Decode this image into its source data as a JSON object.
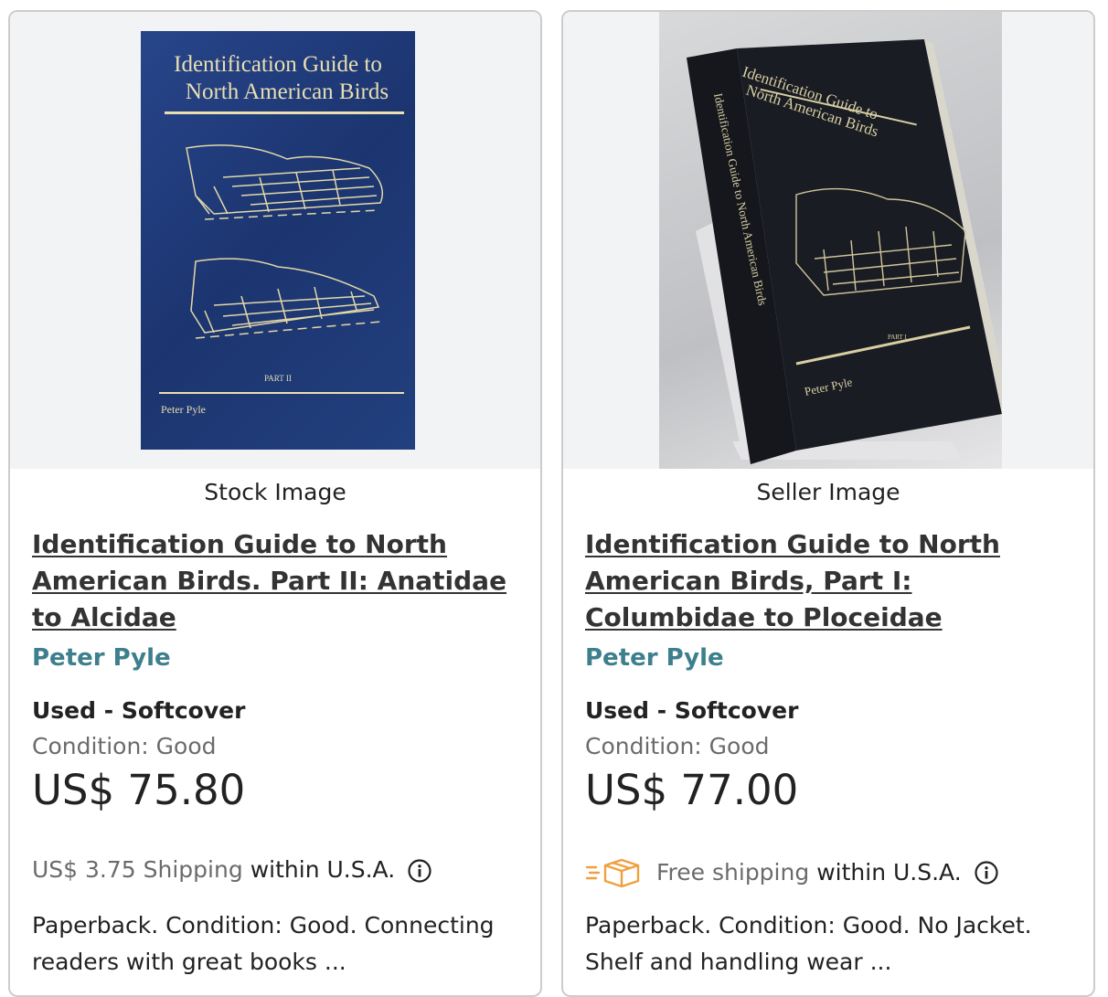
{
  "cards": [
    {
      "image_label": "Stock Image",
      "cover": {
        "title_line1": "Identification Guide to",
        "title_line2": "North American Birds",
        "part": "PART II",
        "author": "Peter Pyle"
      },
      "title": "Identification Guide to North American Birds. Part II: Anatidae to Alcidae",
      "author": "Peter Pyle",
      "binding": "Used - Softcover",
      "condition": "Condition: Good",
      "price": "US$ 75.80",
      "shipping_cost": "US$ 3.75 Shipping",
      "shipping_region": "within U.S.A.",
      "description": "Paperback. Condition: Good. Connecting readers with great books ..."
    },
    {
      "image_label": "Seller Image",
      "cover": {
        "title_line1": "Identification Guide to",
        "title_line2": "North American Birds",
        "spine_text": "Identification Guide to North American Birds",
        "part": "PART I",
        "author": "Peter Pyle"
      },
      "title": "Identification Guide to North American Birds, Part I: Columbidae to Ploceidae",
      "author": "Peter Pyle",
      "binding": "Used - Softcover",
      "condition": "Condition: Good",
      "price": "US$ 77.00",
      "shipping_cost": "Free shipping",
      "shipping_region": "within U.S.A.",
      "shipping_icon": "free-shipping-truck-icon",
      "description": "Paperback. Condition: Good. No Jacket. Shelf and handling wear ..."
    }
  ],
  "colors": {
    "author_link": "#3d7f8c",
    "card_border": "#cccccc",
    "free_shipping_icon": "#f0a040",
    "cover_blue": "#1f3b7a",
    "cover_gold": "#e9dfb0"
  }
}
